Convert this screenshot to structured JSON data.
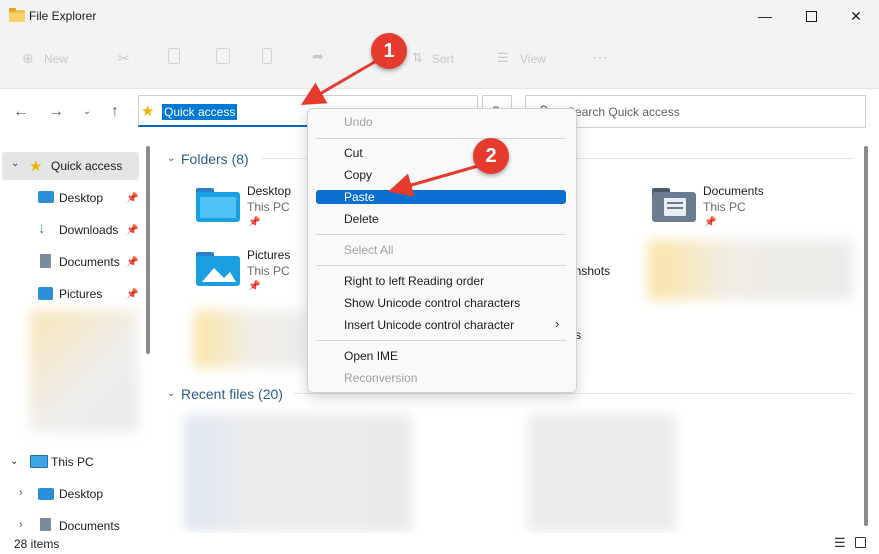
{
  "window": {
    "title": "File Explorer"
  },
  "toolbar": {
    "new_label": "New",
    "sort_label": "Sort",
    "view_label": "View"
  },
  "address": {
    "text": "Quick access"
  },
  "search": {
    "placeholder": "Search Quick access"
  },
  "nav": {
    "quick_access": "Quick access",
    "items": [
      "Desktop",
      "Downloads",
      "Documents",
      "Pictures"
    ],
    "this_pc": "This PC",
    "pc_items": [
      "Desktop",
      "Documents"
    ]
  },
  "main": {
    "folders_header": "Folders (8)",
    "folders": [
      {
        "name": "Desktop",
        "sub": "This PC"
      },
      {
        "name": "Documents",
        "sub": "This PC"
      },
      {
        "name": "Pictures",
        "sub": "This PC"
      }
    ],
    "screenshots_fragment": "enshots",
    "s_fragment": "s",
    "recent_header": "Recent files (20)"
  },
  "context_menu": {
    "undo": "Undo",
    "cut": "Cut",
    "copy": "Copy",
    "paste": "Paste",
    "delete": "Delete",
    "select_all": "Select All",
    "rtl": "Right to left Reading order",
    "show_unicode": "Show Unicode control characters",
    "insert_unicode": "Insert Unicode control character",
    "open_ime": "Open IME",
    "reconversion": "Reconversion"
  },
  "annotations": {
    "step1": "1",
    "step2": "2"
  },
  "status": {
    "items": "28 items"
  },
  "colors": {
    "accent": "#0078d4",
    "badge": "#e53b2f",
    "folder_blue": "#1a8fd6"
  }
}
